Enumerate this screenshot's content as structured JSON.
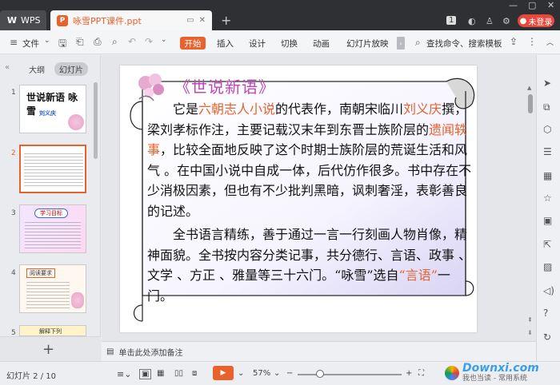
{
  "titlebar": {
    "app_tab": "WPS",
    "doc_tab": "咏雪PPT课件.ppt",
    "login": "未登录",
    "page_badge": "1"
  },
  "ribbon": {
    "file": "文件",
    "tabs": [
      "开始",
      "插入",
      "设计",
      "切换",
      "动画",
      "幻灯片放映"
    ],
    "search": "查找命令、搜索模板"
  },
  "left_panel": {
    "tab_outline": "大纲",
    "tab_slides": "幻灯片",
    "thumbs": [
      {
        "num": "1",
        "text": "世说新语 咏雪",
        "sub": "刘义庆"
      },
      {
        "num": "2",
        "text": ""
      },
      {
        "num": "3",
        "text": "学习目标"
      },
      {
        "num": "4",
        "text": "阅读要求"
      },
      {
        "num": "5",
        "text": "解释下列"
      }
    ],
    "add": "+"
  },
  "slide": {
    "title": "《世说新语》",
    "p1_a": "它是",
    "p1_hl1": "六朝志人小说",
    "p1_b": "的代表作，南朝宋临川",
    "p1_hl2": "刘义庆",
    "p1_c": "撰，梁刘孝标作注，主要记载汉末年到东晋士族阶层的",
    "p1_hl3": "遗闻轶事",
    "p1_d": "，比较全面地反映了这个时期士族阶层的荒诞生活和风气 。在中国小说中自成一体，后代仿作很多。书中存在不少消极因素，但也有不少批判黑暗，讽刺奢淫，表彰善良的记述。",
    "p2_a": "全书语言精练，善于通过一言一行刻画人物肖像，精神面貌。全书按内容分类记事，共分德行、言语、政事 、文学 、方正 、雅量等三十六门。“咏雪”选自",
    "p2_hl": "“言语”",
    "p2_b": "一门。"
  },
  "notes": {
    "placeholder": "单击此处添加备注"
  },
  "status": {
    "slide_info": "幻灯片 2 / 10",
    "zoom": "57%",
    "watermark": "Downxi.com",
    "watermark_sub": "我也当读 - 常用系统"
  },
  "colors": {
    "accent": "#e8622d",
    "title_pink": "#c146b8",
    "login_red": "#e8473c"
  }
}
